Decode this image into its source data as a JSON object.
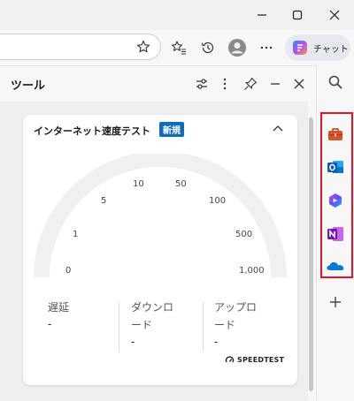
{
  "browser": {
    "copilot_label": "チャット"
  },
  "panel": {
    "title": "ツール"
  },
  "speedtest": {
    "title": "インターネット速度テスト",
    "badge": "新規",
    "gauge_labels": [
      "0",
      "1",
      "5",
      "10",
      "50",
      "100",
      "500",
      "1,000"
    ],
    "metrics": {
      "latency": {
        "label": "遅延",
        "value": "-"
      },
      "download": {
        "label_line1": "ダウンロ",
        "label_line2": "ード",
        "value": "-"
      },
      "upload": {
        "label_line1": "アップロ",
        "label_line2": "ード",
        "value": "-"
      }
    },
    "brand": "SPEEDTEST"
  },
  "colors": {
    "accent": "#0f6cbd",
    "highlight": "#e3132b"
  }
}
